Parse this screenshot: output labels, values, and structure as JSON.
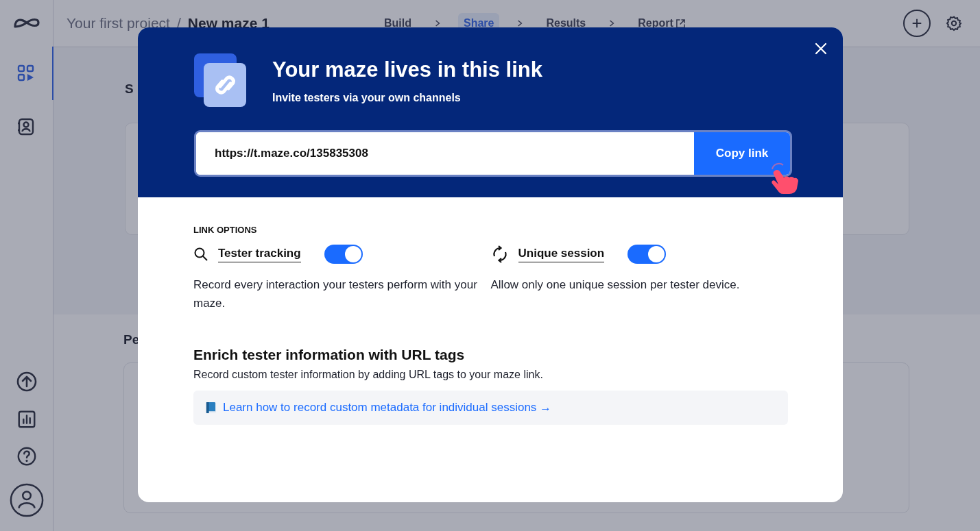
{
  "sidebar": {
    "items": [
      {
        "kind": "dashboard",
        "selected": true
      },
      {
        "kind": "contacts",
        "selected": false
      }
    ],
    "bottom_items": [
      {
        "kind": "upload"
      },
      {
        "kind": "chart"
      },
      {
        "kind": "help"
      },
      {
        "kind": "avatar"
      }
    ]
  },
  "breadcrumb": {
    "project": "Your first project",
    "separator": "/",
    "maze": "New maze 1"
  },
  "steps": [
    {
      "label": "Build",
      "selected": false,
      "external": false
    },
    {
      "label": "Share",
      "selected": true,
      "external": false
    },
    {
      "label": "Results",
      "selected": false,
      "external": false
    },
    {
      "label": "Report",
      "selected": false,
      "external": true
    }
  ],
  "background": {
    "section_heading": "S",
    "section_2_heading": "Pe"
  },
  "modal": {
    "title": "Your maze lives in this link",
    "subtitle": "Invite testers via your own channels",
    "link_value": "https://t.maze.co/135835308",
    "copy_button": "Copy link",
    "options_heading": "LINK OPTIONS",
    "options": [
      {
        "kind": "search",
        "label": "Tester tracking",
        "on": true,
        "description": "Record every interaction your testers perform with your maze."
      },
      {
        "kind": "refresh",
        "label": "Unique session",
        "on": true,
        "description": "Allow only one unique session per tester device."
      }
    ],
    "tags_heading": "Enrich tester information with URL tags",
    "tags_description": "Record custom tester information by adding URL tags to your maze link.",
    "learn_link": "Learn how to record custom metadata for individual sessions →"
  }
}
